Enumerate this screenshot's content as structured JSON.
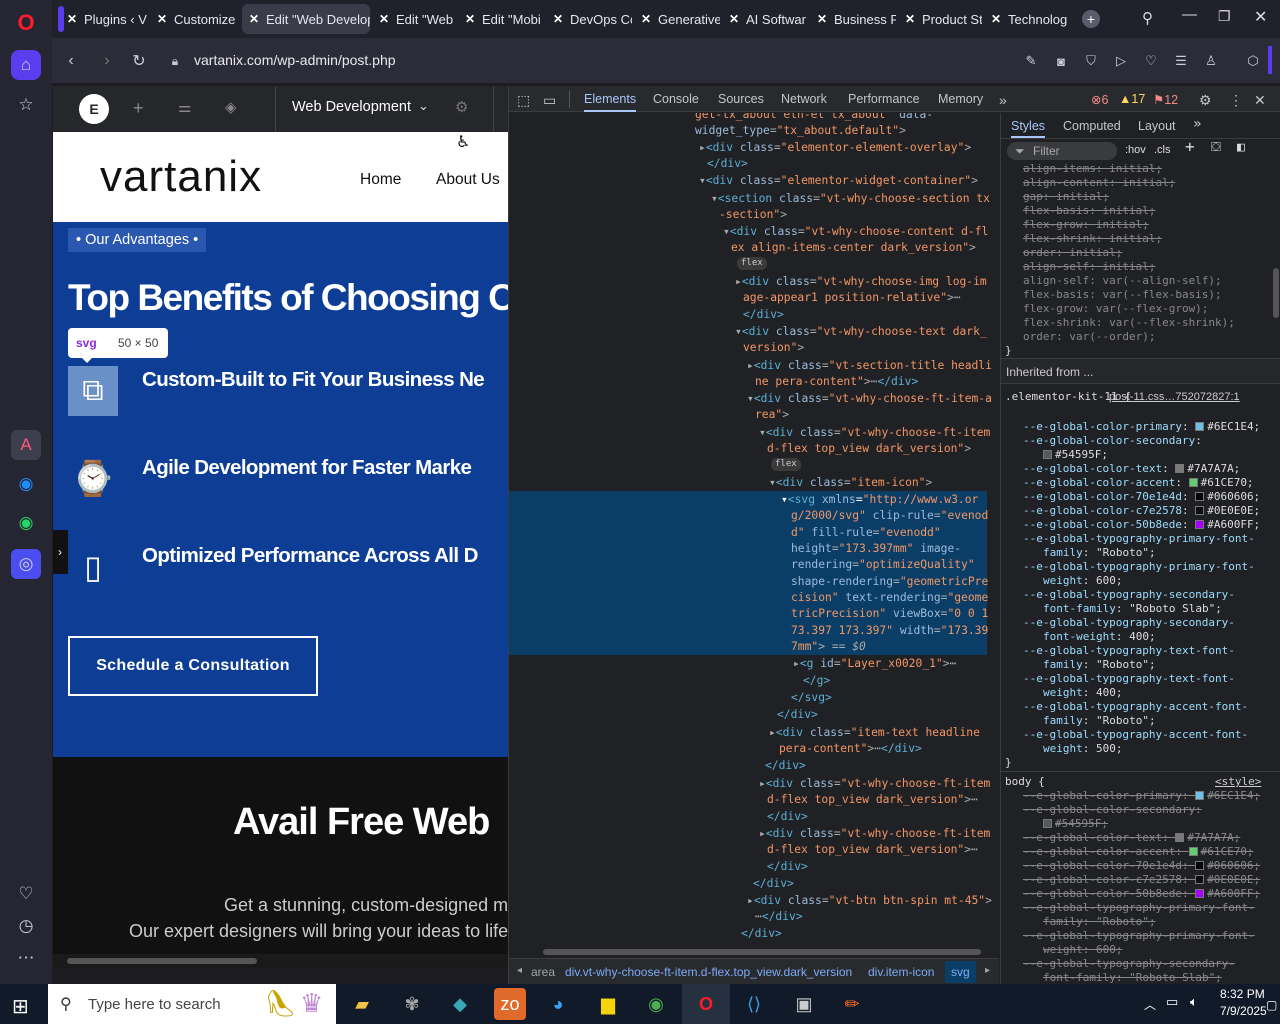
{
  "tabs": [
    {
      "label": "Plugins ‹ V",
      "icon": "wordpress-icon"
    },
    {
      "label": "Customize",
      "icon": "wordpress-icon"
    },
    {
      "label": "Edit \"Web Develop",
      "icon": "wordpress-icon",
      "active": true
    },
    {
      "label": "Edit \"Web",
      "icon": "wordpress-icon"
    },
    {
      "label": "Edit \"Mobi",
      "icon": "wordpress-icon"
    },
    {
      "label": "DevOps Cc",
      "icon": "wordpress-icon"
    },
    {
      "label": "Generative",
      "icon": "wordpress-icon"
    },
    {
      "label": "AI Softwar",
      "icon": "wordpress-icon"
    },
    {
      "label": "Business P",
      "icon": "wordpress-icon"
    },
    {
      "label": "Product St",
      "icon": "wordpress-icon"
    },
    {
      "label": "Technolog",
      "icon": "wordpress-icon"
    }
  ],
  "address": {
    "url": "vartanix.com/wp-admin/post.php"
  },
  "editor": {
    "page_name": "Web Development"
  },
  "site": {
    "logo": "vartanix",
    "nav": [
      "Home",
      "About Us"
    ],
    "badge": "• Our Advantages •",
    "heading": "Top Benefits of Choosing Ou",
    "tooltip_tag": "svg",
    "tooltip_size": "50 × 50",
    "features": [
      "Custom-Built to Fit Your Business Ne",
      "Agile Development for Faster Marke",
      "Optimized Performance Across All D"
    ],
    "cta": "Schedule a Consultation",
    "avail_heading": "Avail Free Web",
    "para1": "Get a stunning, custom-designed m",
    "para2": "Our expert designers will bring your ideas to life"
  },
  "devtools": {
    "tabs": [
      "Elements",
      "Console",
      "Sources",
      "Network",
      "Performance",
      "Memory"
    ],
    "errors": "6",
    "warnings": "17",
    "issues": "12",
    "styles_tabs": [
      "Styles",
      "Computed",
      "Layout"
    ],
    "filter_placeholder": "Filter",
    "hov": ":hov",
    "cls": ".cls",
    "inherited": "Inherited from ...",
    "rule1_selector": ".elementor-kit-11 {",
    "rule1_source": "post-11.css…752072827:1",
    "rule2_selector": "body {",
    "rule2_source": "<style>",
    "breadcrumbs": [
      "area",
      "div.vt-why-choose-ft-item.d-flex.top_view.dark_version",
      "div.item-icon",
      "svg"
    ]
  },
  "taskbar": {
    "search_placeholder": "Type here to search",
    "time": "8:32 PM",
    "date": "7/9/2025"
  },
  "colors": {
    "primary": "#6EC1E4",
    "secondary": "#54595F",
    "text": "#7A7A7A",
    "accent": "#61CE70",
    "c70": "#060606",
    "c7e": "#0E0E0E",
    "c50": "#A600FF",
    "site_blue": "#0d3d95"
  }
}
